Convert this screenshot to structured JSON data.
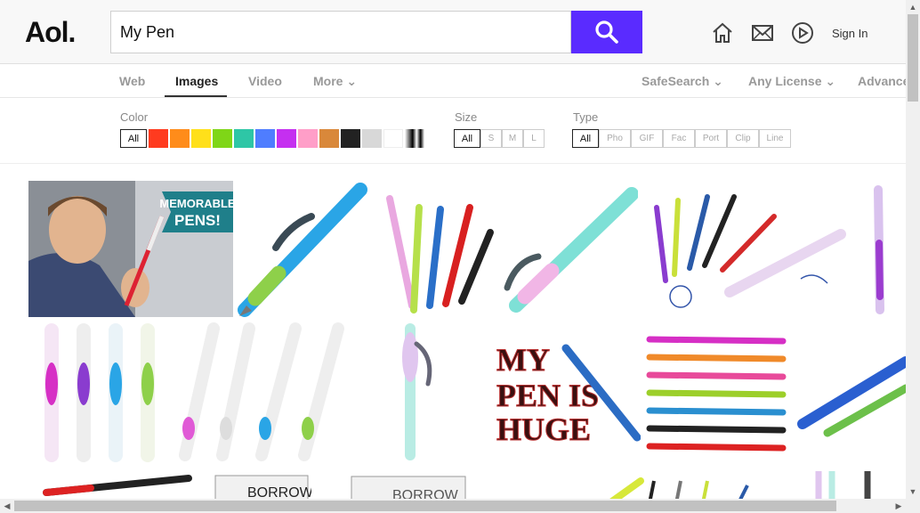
{
  "header": {
    "logo": "Aol.",
    "search_value": "My Pen",
    "search_icon": "search-icon",
    "icons": [
      "home-icon",
      "mail-icon",
      "play-icon"
    ],
    "sign_in": "Sign In"
  },
  "tabs": [
    {
      "label": "Web"
    },
    {
      "label": "Images"
    },
    {
      "label": "Video"
    },
    {
      "label": "More ⌄"
    },
    {
      "label": "SafeSearch ⌄"
    },
    {
      "label": "Any License ⌄"
    },
    {
      "label": "Advance"
    }
  ],
  "filters": {
    "color_label": "Color",
    "color_all": "All",
    "colors": [
      "#ff3b1f",
      "#ff8c1a",
      "#ffe01a",
      "#7fd617",
      "#2ec6a6",
      "#4f7dff",
      "#c52ff0",
      "#ff9ec8",
      "#d9883a",
      "#222222",
      "#d8d8d8",
      "#ffffff"
    ],
    "size_label": "Size",
    "sizes": [
      "All",
      "S",
      "M",
      "L"
    ],
    "type_label": "Type",
    "types": [
      "All",
      "Pho",
      "GIF",
      "Fac",
      "Port",
      "Clip",
      "Line"
    ]
  },
  "results": {
    "img1_caption_line1": "MEMORABLE",
    "img1_caption_line2": "PENS!",
    "img8_text_line1": "MY",
    "img8_text_line2": "PEN IS",
    "img8_text_line3": "HUGE",
    "img12_text": "BORROW",
    "img13_text": "BORROW"
  }
}
